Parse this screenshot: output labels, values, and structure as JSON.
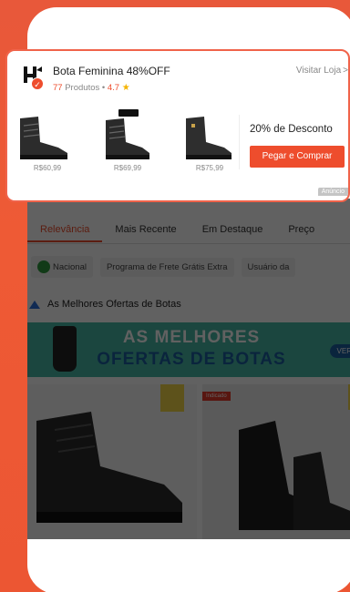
{
  "ad_card": {
    "shop_name": "Bota Feminina 48%OFF",
    "products_count": "77",
    "products_label": "Produtos",
    "separator": "•",
    "rating": "4.7",
    "visit_store_label": "Visitar Loja",
    "chevron_glyph": ">",
    "verified_glyph": "✓",
    "star_glyph": "★",
    "items": [
      {
        "price": "R$60,99"
      },
      {
        "price": "R$69,99"
      },
      {
        "price": "R$75,99"
      }
    ],
    "discount_text": "20% de Desconto",
    "cta_label": "Pegar e Comprar",
    "ad_badge": "Anúncio"
  },
  "background": {
    "tabs": [
      "Relevância",
      "Mais Recente",
      "Em Destaque",
      "Preço"
    ],
    "filters": [
      "Nacional",
      "Programa de Frete Grátis Extra",
      "Usuário da"
    ],
    "section_title": "As Melhores Ofertas de Botas",
    "banner_line1": "AS MELHORES",
    "banner_line2": "OFERTAS DE BOTAS",
    "banner_button": "VER",
    "card_tag": "Indicado"
  },
  "colors": {
    "brand": "#ee4d2d",
    "background_orange": "#ec5633",
    "banner_teal": "#49b8a5"
  }
}
